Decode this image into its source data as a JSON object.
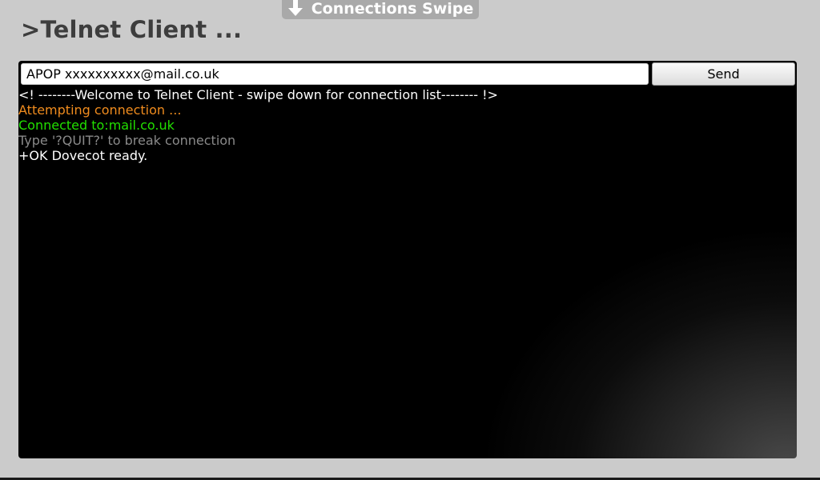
{
  "swipe_tab": {
    "label": "Connections Swipe",
    "icon": "arrow-down-icon"
  },
  "header": {
    "title": ">Telnet Client ..."
  },
  "command": {
    "value": "APOP xxxxxxxxxx@mail.co.uk",
    "send_label": "Send"
  },
  "log": {
    "lines": [
      {
        "text": "<! --------Welcome to Telnet Client - swipe down for connection list-------- !>",
        "color": "#ffffff"
      },
      {
        "text": "Attempting connection ...",
        "color": "#f08c1e"
      },
      {
        "text": "Connected to:mail.co.uk",
        "color": "#22e000"
      },
      {
        "text": "Type '?QUIT?' to break connection",
        "color": "#8a8a8a"
      },
      {
        "text": "+OK Dovecot ready.",
        "color": "#ffffff"
      }
    ]
  },
  "colors": {
    "background": "#cbcbcb",
    "console": "#000000",
    "title": "#3d3d3d"
  }
}
